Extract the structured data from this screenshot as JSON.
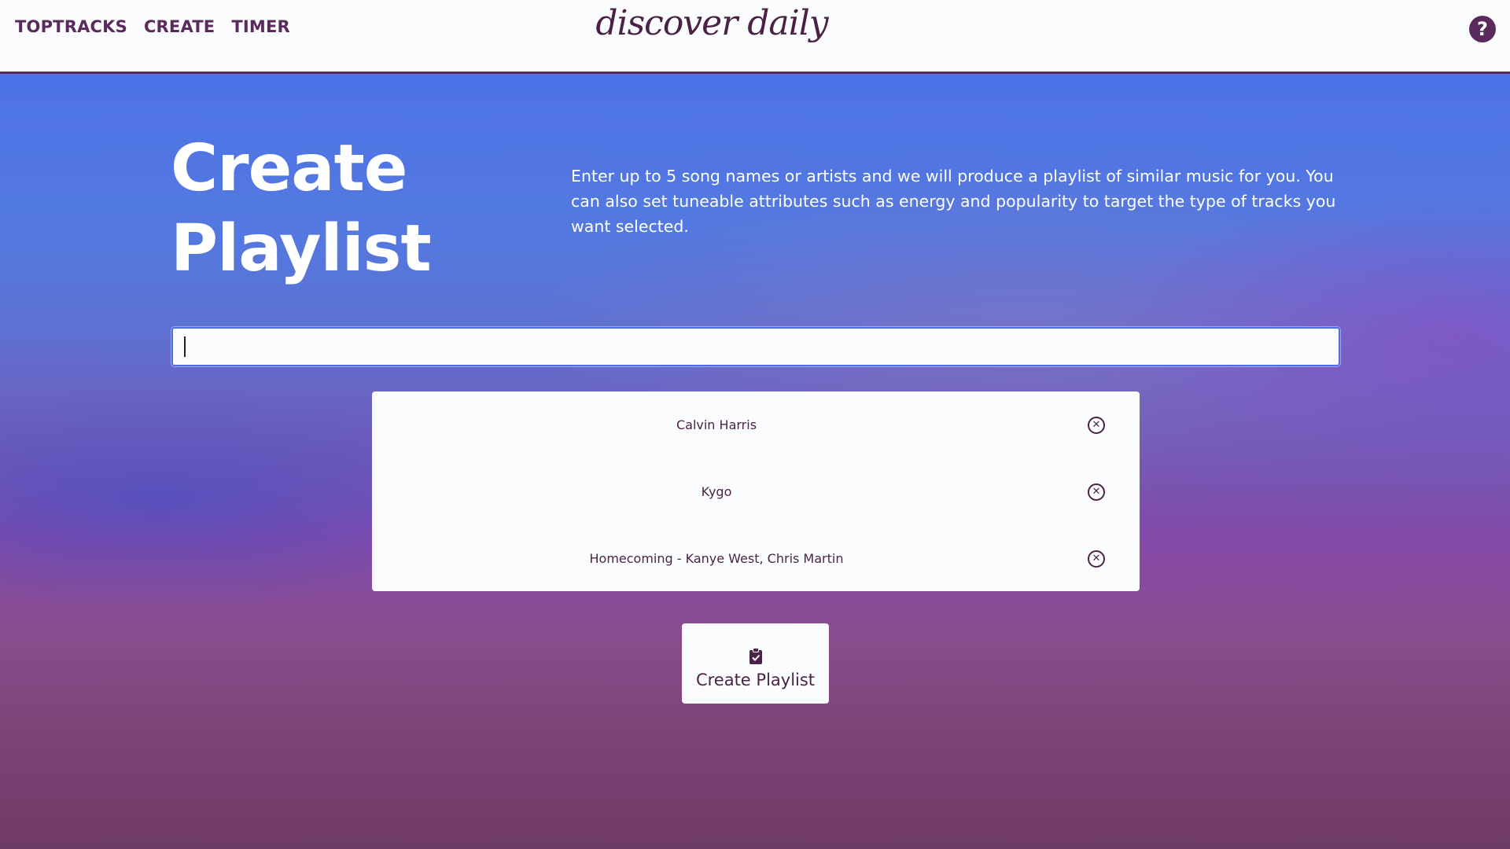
{
  "nav": {
    "links": [
      "TOPTRACKS",
      "CREATE",
      "TIMER"
    ],
    "logo": "discover daily",
    "help_label": "?"
  },
  "hero": {
    "title_line1": "Create",
    "title_line2": "Playlist",
    "description": "Enter up to 5 song names or artists and we will produce a playlist of similar music for you. You can also set tuneable attributes such as energy and popularity to target the type of tracks you want selected."
  },
  "search": {
    "value": "",
    "placeholder": ""
  },
  "selections": [
    {
      "label": "Calvin Harris",
      "remove_icon": "close-circle-icon"
    },
    {
      "label": "Kygo",
      "remove_icon": "close-circle-icon"
    },
    {
      "label": "Homecoming - Kanye West, Chris Martin",
      "remove_icon": "close-circle-icon"
    }
  ],
  "create_button": {
    "label": "Create Playlist",
    "icon": "clipboard-check-icon"
  },
  "colors": {
    "nav_text": "#5b2a5c",
    "nav_bg": "#fbfcfd",
    "gradient_top": "#4e72e8",
    "gradient_mid": "#8549a8",
    "gradient_bottom": "#6e3a66"
  }
}
